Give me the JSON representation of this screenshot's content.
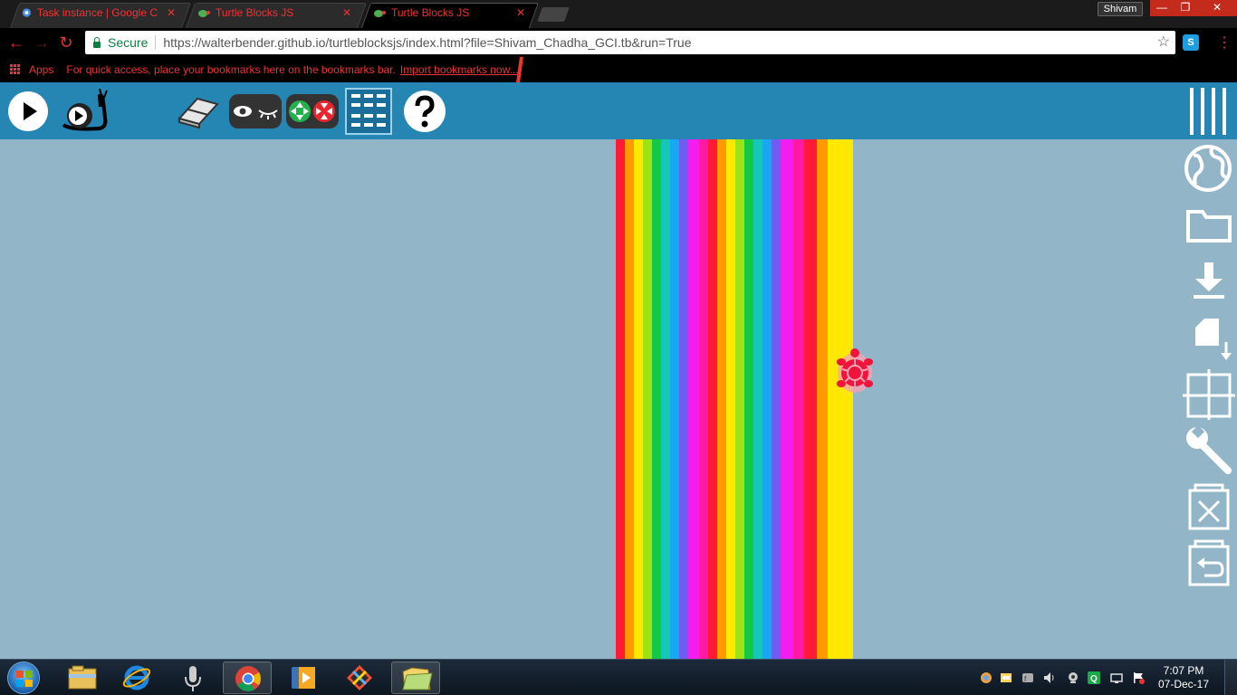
{
  "browser": {
    "tabs": [
      {
        "title": "Task instance | Google C",
        "icon": "gear-favicon-icon"
      },
      {
        "title": "Turtle Blocks JS",
        "icon": "turtle-favicon-icon"
      },
      {
        "title": "Turtle Blocks JS",
        "icon": "turtle-favicon-icon",
        "active": true
      }
    ],
    "profile_name": "Shivam",
    "secure_label": "Secure",
    "url": "https://walterbender.github.io/turtleblocksjs/index.html?file=Shivam_Chadha_GCI.tb&run=True",
    "bookmarks": {
      "apps_label": "Apps",
      "message": "For quick access, place your bookmarks here on the bookmarks bar.",
      "import_link": "Import bookmarks now..."
    },
    "extension_label": "S"
  },
  "app": {
    "toolbar": [
      "play-button",
      "run-slow-button",
      "clear-button",
      "hide-blocks-button",
      "collapse-expand-button",
      "stats-button",
      "help-button"
    ],
    "menu": "menu-icon",
    "side_palette": [
      "planet-icon",
      "open-folder-icon",
      "save-download-icon",
      "save-plugin-icon",
      "grid-icon",
      "settings-wrench-icon",
      "delete-icon",
      "restore-trash-icon"
    ],
    "accent_color": "#2585b3",
    "canvas_color": "#92b5c8",
    "turtle_color": "#f0143c"
  },
  "taskbar": {
    "apps": [
      "windows-explorer-icon",
      "internet-explorer-icon",
      "speech-recognition-icon",
      "chrome-icon",
      "media-player-icon",
      "git-icon",
      "file-manager-icon"
    ],
    "clock_time": "7:07 PM",
    "clock_date": "07-Dec-17"
  }
}
